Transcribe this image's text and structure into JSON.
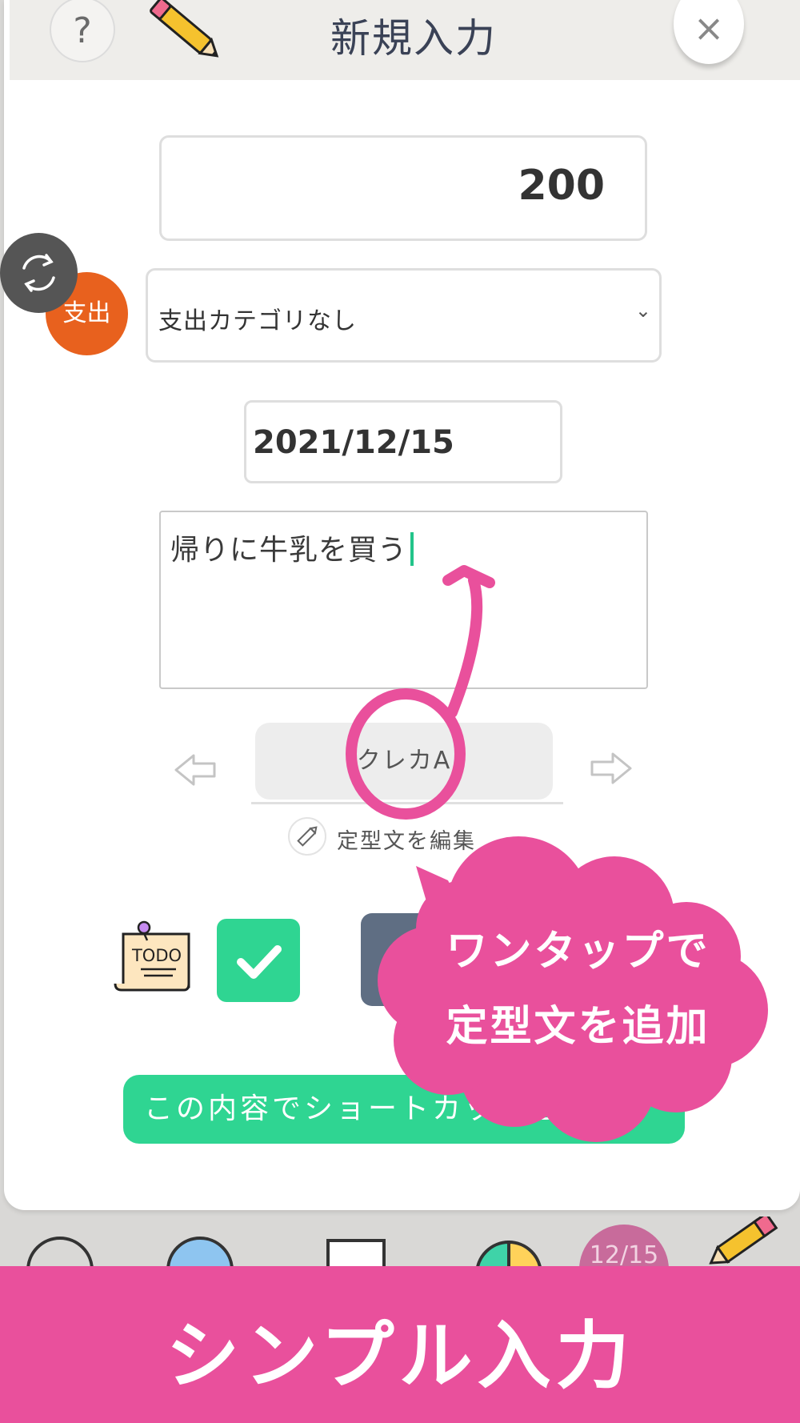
{
  "header": {
    "help_label": "?",
    "title": "新規入力",
    "close_label": "×"
  },
  "form": {
    "amount": "200",
    "entry_type": "支出",
    "category": "支出カテゴリなし",
    "date": "2021/12/15",
    "memo": "帰りに牛乳を買う",
    "template_chip": "クレカA",
    "edit_templates_label": "定型文を編集",
    "shortcut_button": "この内容でショートカットを作る"
  },
  "todo_icon_text": "TODO",
  "annotation": {
    "bubble_line1": "ワンタップで",
    "bubble_line2": "定型文を追加"
  },
  "bottom_nav": {
    "date_badge": "12/15"
  },
  "banner": {
    "text": "シンプル入力"
  },
  "colors": {
    "accent_green": "#2fd592",
    "expense_orange": "#e8611e",
    "annotation_pink": "#e9509c",
    "title_navy": "#3a4256"
  },
  "icons": [
    "help-icon",
    "pencil-icon",
    "close-icon",
    "sync-icon",
    "chevron-down-icon",
    "arrow-left-icon",
    "arrow-right-icon",
    "edit-pencil-icon",
    "todo-note-icon",
    "check-icon"
  ]
}
